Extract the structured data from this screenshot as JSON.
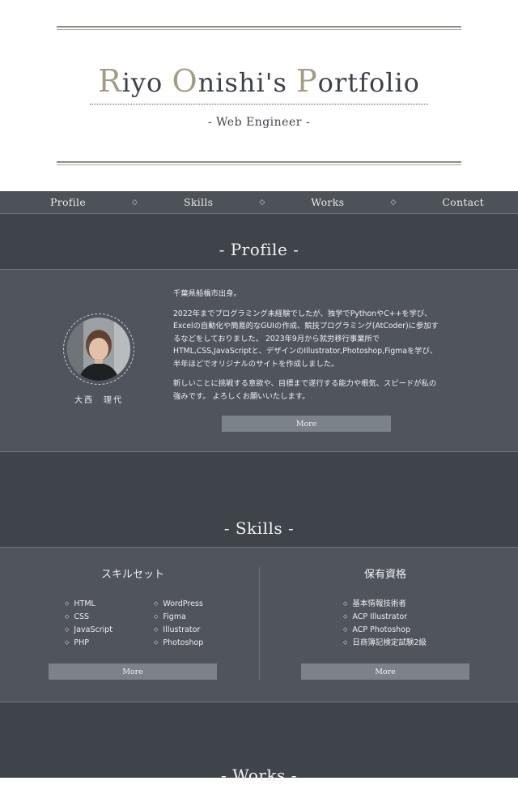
{
  "header": {
    "title_parts": [
      {
        "cap": "R",
        "rest": "iyo "
      },
      {
        "cap": "O",
        "rest": "nishi's "
      },
      {
        "cap": "P",
        "rest": "ortfolio"
      }
    ],
    "tagline": "- Web Engineer -"
  },
  "nav": {
    "items": [
      "Profile",
      "Skills",
      "Works",
      "Contact"
    ],
    "separator": "◇"
  },
  "profile": {
    "heading": "- Profile -",
    "name": "大西　理代",
    "paragraphs": [
      "千葉県船橋市出身。",
      "2022年までプログラミング未経験でしたが、独学でPythonやC++を学び、Excelの自動化や簡易的なGUIの作成、競技プログラミング(AtCoder)に参加するなどをしておりました。 2023年9月から就労移行事業所でHTML,CSS,JavaScriptと、デザインのIllustrator,Photoshop,Figmaを学び、半年ほどでオリジナルのサイトを作成しました。",
      "新しいことに挑戦する意欲や、目標まで遂行する能力や根気、スピードが私の強みです。 よろしくお願いいたします。"
    ],
    "more_label": "More"
  },
  "skills": {
    "heading": "- Skills -",
    "skillset_title": "スキルセット",
    "skillset_col1": [
      "HTML",
      "CSS",
      "JavaScript",
      "PHP"
    ],
    "skillset_col2": [
      "WordPress",
      "Figma",
      "Illustrator",
      "Photoshop"
    ],
    "certs_title": "保有資格",
    "certs": [
      "基本情報技術者",
      "ACP Illustrator",
      "ACP Photoshop",
      "日商簿記検定試験2級"
    ],
    "more_label_left": "More",
    "more_label_right": "More"
  },
  "works": {
    "heading": "- Works -"
  }
}
